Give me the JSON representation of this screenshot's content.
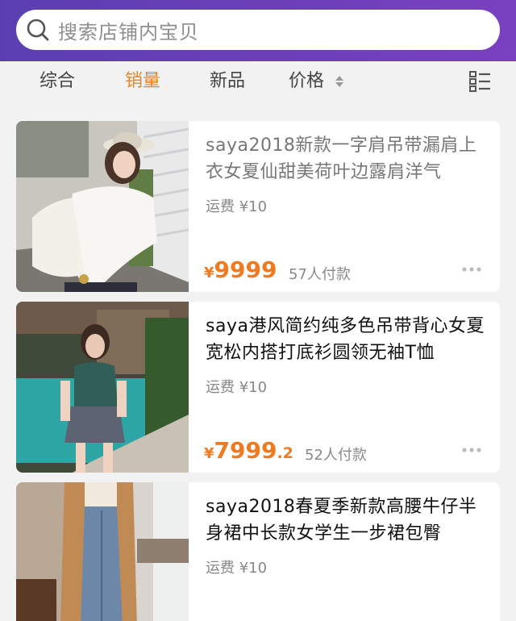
{
  "search": {
    "placeholder": "搜索店铺内宝贝"
  },
  "filters": [
    {
      "label": "综合",
      "active": false
    },
    {
      "label": "销量",
      "active": true
    },
    {
      "label": "新品",
      "active": false
    },
    {
      "label": "价格",
      "active": false
    }
  ],
  "colors": {
    "header_start": "#5b3fb0",
    "header_end": "#7a40c0",
    "accent": "#f08225",
    "price": "#f07a20"
  },
  "products": [
    {
      "title": "saya2018新款一字肩吊带漏肩上衣女夏仙甜美荷叶边露肩洋气",
      "shipping": "运费 ¥10",
      "price_symbol": "¥",
      "price_main": "9999",
      "price_decimal": "",
      "paid": "57人付款"
    },
    {
      "title": "saya港风简约纯多色吊带背心女夏宽松内搭打底衫圆领无袖T恤",
      "shipping": "运费 ¥10",
      "price_symbol": "¥",
      "price_main": "7999",
      "price_decimal": ".2",
      "paid": "52人付款"
    },
    {
      "title": "saya2018春夏季新款高腰牛仔半身裙中长款女学生一步裙包臀",
      "shipping": "运费 ¥10"
    }
  ],
  "icons": {
    "search": "search-icon",
    "sort": "sort-arrows-icon",
    "layout": "list-layout-icon",
    "more": "more-dots-icon"
  }
}
